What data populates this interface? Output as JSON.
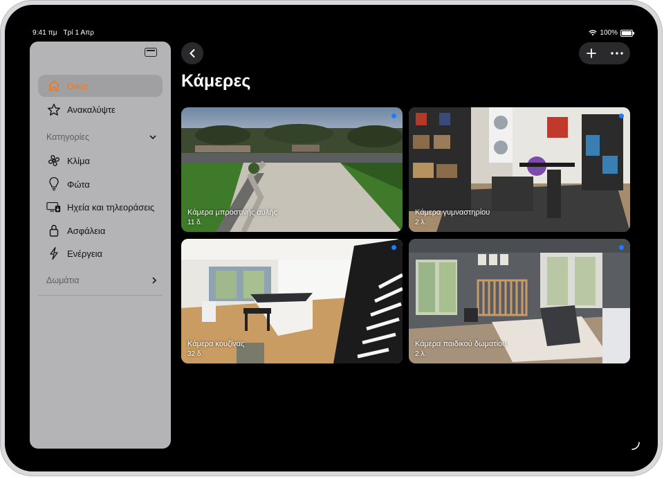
{
  "status_bar": {
    "time": "9:41 πμ",
    "date": "Τρί 1 Απρ",
    "battery": "100%"
  },
  "sidebar": {
    "items": [
      {
        "label": "Οικία",
        "icon": "house-icon",
        "selected": true
      },
      {
        "label": "Ανακαλύψτε",
        "icon": "star-icon",
        "selected": false
      }
    ],
    "categories_header": "Κατηγορίες",
    "categories": [
      {
        "label": "Κλίμα",
        "icon": "fan-icon"
      },
      {
        "label": "Φώτα",
        "icon": "lightbulb-icon"
      },
      {
        "label": "Ηχεία και τηλεοράσεις",
        "icon": "tv-speaker-icon"
      },
      {
        "label": "Ασφάλεια",
        "icon": "lock-icon"
      },
      {
        "label": "Ενέργεια",
        "icon": "bolt-icon"
      }
    ],
    "rooms_header": "Δωμάτια"
  },
  "main": {
    "title": "Κάμερες",
    "cameras": [
      {
        "name": "Κάμερα μπροστινής αυλής",
        "time": "11 δ."
      },
      {
        "name": "Κάμερα γυμναστηρίου",
        "time": "2 λ."
      },
      {
        "name": "Κάμερα κουζίνας",
        "time": "32 δ."
      },
      {
        "name": "Κάμερα παιδικού δωματίου",
        "time": "2 λ."
      }
    ]
  },
  "colors": {
    "accent": "#f07a1a",
    "live_indicator": "#1f7bff",
    "sidebar_bg": "#b4b4b6",
    "screen_bg": "#000000"
  }
}
